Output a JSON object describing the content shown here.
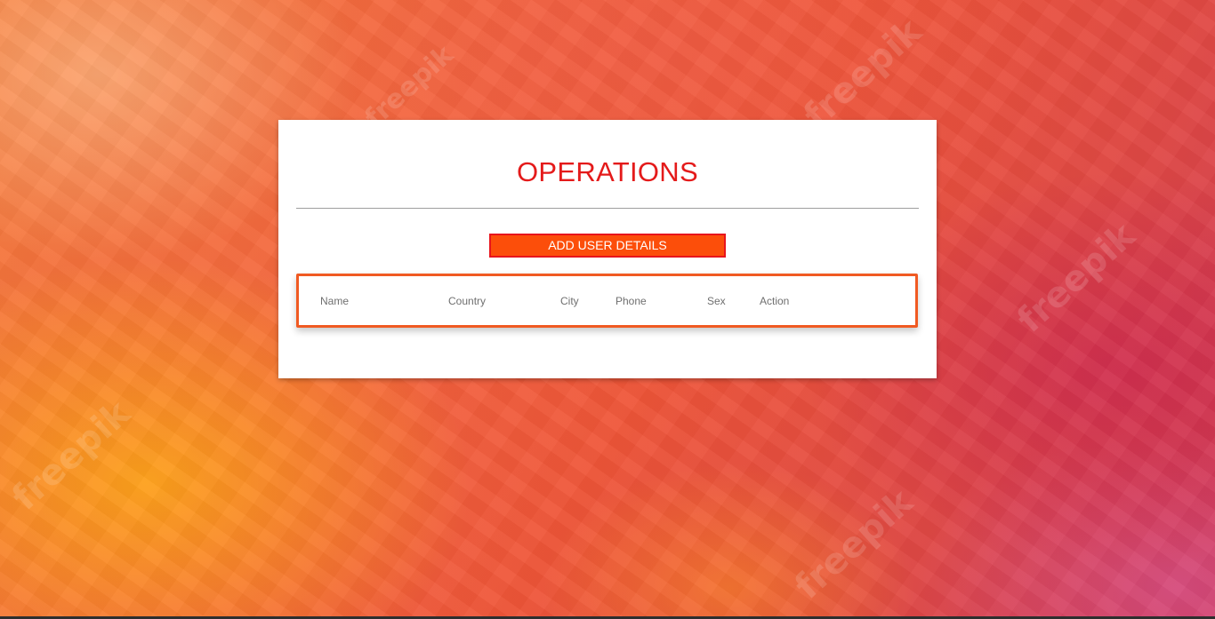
{
  "page": {
    "title": "OPERATIONS",
    "watermark": "freepik"
  },
  "actions": {
    "add_label": "ADD USER DETAILS"
  },
  "table": {
    "columns": [
      "Name",
      "Country",
      "City",
      "Phone",
      "Sex",
      "Action"
    ],
    "rows": []
  },
  "colors": {
    "title": "#e41a1a",
    "button_bg": "#fc4e0a",
    "button_border": "#e8141c",
    "table_border": "#f05a22"
  }
}
